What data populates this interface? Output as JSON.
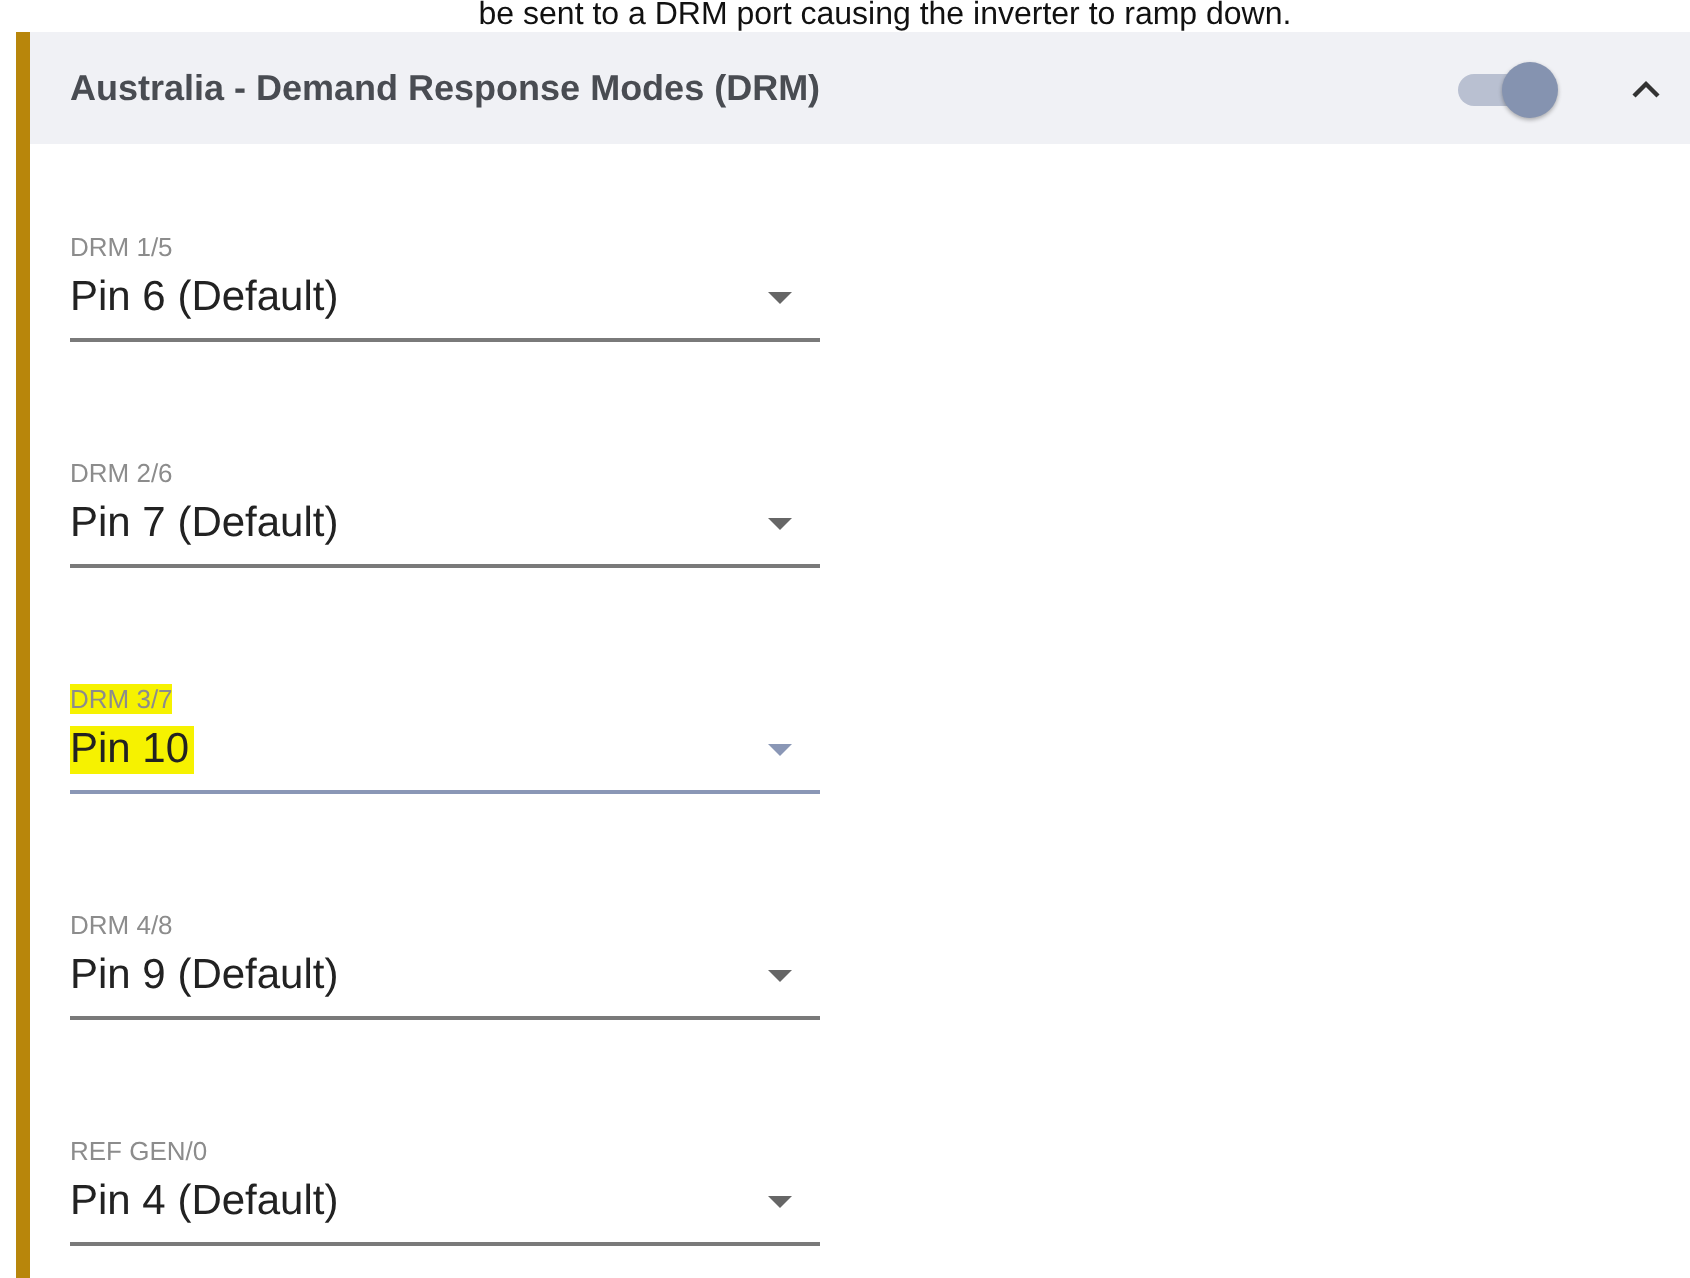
{
  "caption": "be sent to a DRM port causing the inverter to ramp down.",
  "panel": {
    "title": "Australia - Demand Response Modes (DRM)",
    "enabled": true,
    "expanded": true
  },
  "fields": [
    {
      "label": "DRM 1/5",
      "value": "Pin 6 (Default)",
      "focused": false,
      "highlighted": false
    },
    {
      "label": "DRM 2/6",
      "value": "Pin 7 (Default)",
      "focused": false,
      "highlighted": false
    },
    {
      "label": "DRM 3/7",
      "value": "Pin 10",
      "focused": true,
      "highlighted": true
    },
    {
      "label": "DRM 4/8",
      "value": "Pin 9 (Default)",
      "focused": false,
      "highlighted": false
    },
    {
      "label": "REF GEN/0",
      "value": "Pin 4 (Default)",
      "focused": false,
      "highlighted": false
    }
  ]
}
